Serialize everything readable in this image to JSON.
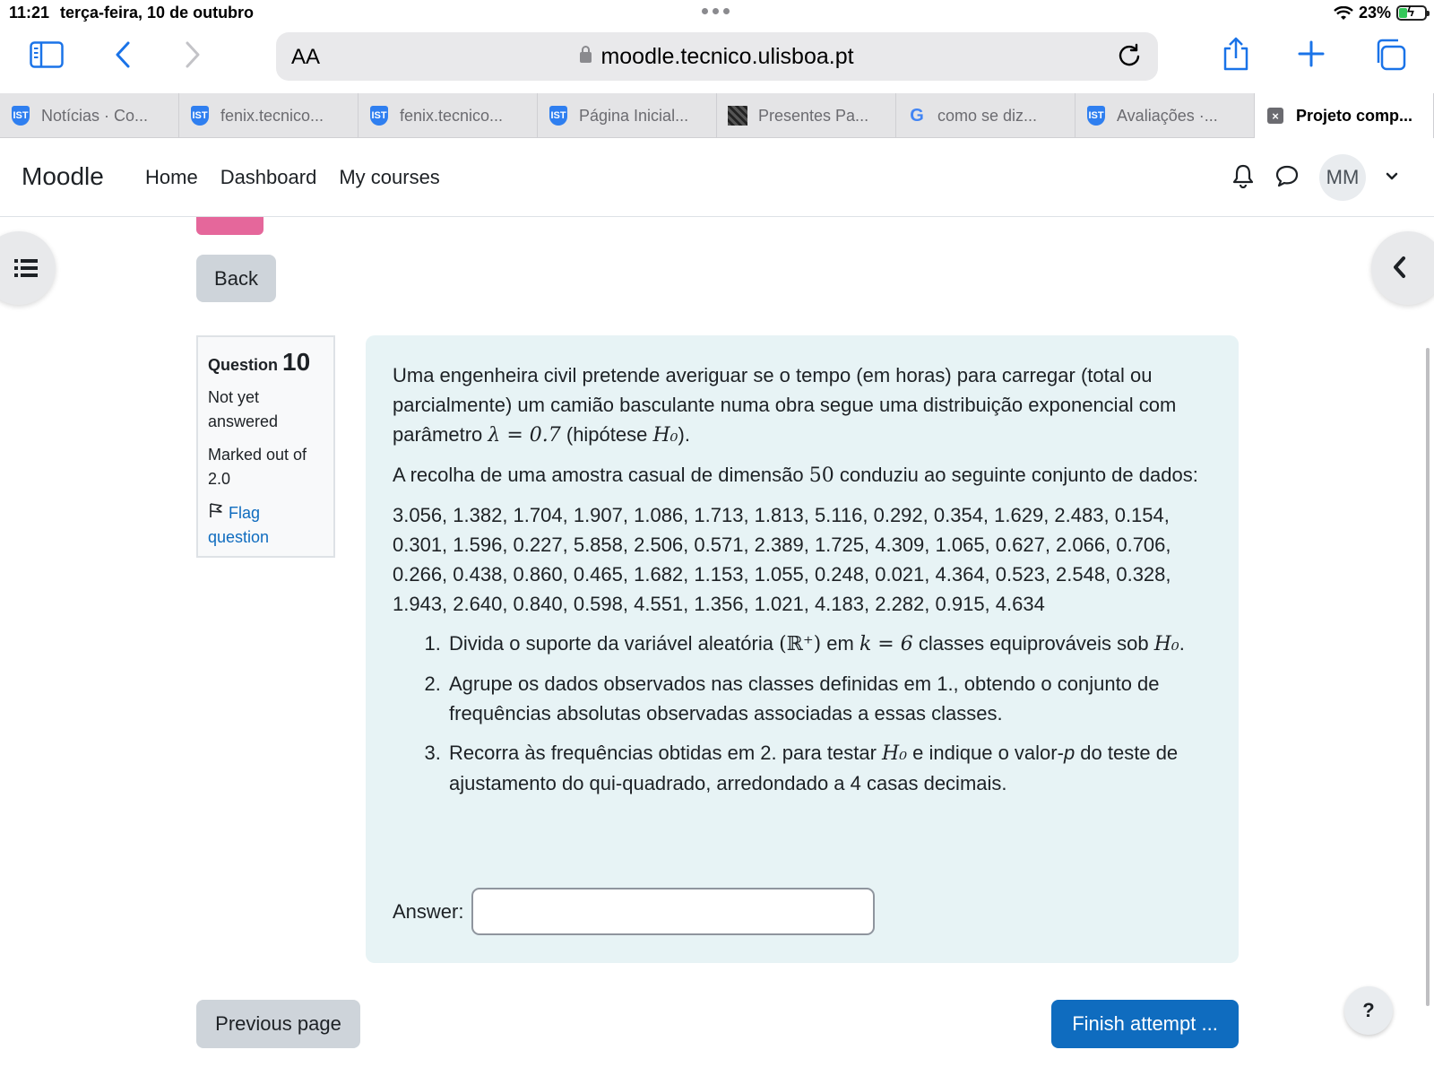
{
  "status": {
    "time": "11:21",
    "date": "terça-feira, 10 de outubro",
    "battery": "23%"
  },
  "browser": {
    "aa_label": "AA",
    "url": "moodle.tecnico.ulisboa.pt",
    "tabs": [
      {
        "label": "Notícias · Co...",
        "icon": "shield-icon"
      },
      {
        "label": "fenix.tecnico...",
        "icon": "shield-icon"
      },
      {
        "label": "fenix.tecnico...",
        "icon": "shield-icon"
      },
      {
        "label": "Página Inicial...",
        "icon": "shield-icon"
      },
      {
        "label": "Presentes Pa...",
        "icon": "pattern-icon"
      },
      {
        "label": "como se diz...",
        "icon": "google-icon"
      },
      {
        "label": "Avaliações ·...",
        "icon": "shield-icon"
      },
      {
        "label": "Projeto comp...",
        "icon": "close-icon",
        "active": true
      }
    ]
  },
  "nav": {
    "brand": "Moodle",
    "links": [
      "Home",
      "Dashboard",
      "My courses"
    ],
    "user_initials": "MM"
  },
  "back_label": "Back",
  "question_info": {
    "prefix": "Question",
    "number": "10",
    "state": "Not yet answered",
    "marks": "Marked out of 2.0",
    "flag": "Flag question"
  },
  "question": {
    "p1_a": "Uma engenheira civil pretende averiguar se o tempo (em horas) para carregar (total ou parcialmente) um camião basculante numa obra segue uma distribuição exponencial com parâmetro ",
    "p1_math": "λ = 0.7",
    "p1_b": " (hipótese ",
    "h0": "H₀",
    "p1_c": ").",
    "p2_a": "A recolha de uma amostra casual de dimensão ",
    "p2_n": "50",
    "p2_b": " conduziu ao seguinte conjunto de dados:",
    "data": "3.056, 1.382, 1.704, 1.907, 1.086, 1.713, 1.813, 5.116, 0.292, 0.354, 1.629, 2.483, 0.154, 0.301, 1.596, 0.227, 5.858, 2.506, 0.571, 2.389, 1.725, 4.309, 1.065, 0.627, 2.066, 0.706, 0.266, 0.438, 0.860, 0.465, 1.682, 1.153, 1.055, 0.248, 0.021, 4.364, 0.523, 2.548, 0.328, 1.943, 2.640, 0.840, 0.598, 4.551, 1.356, 1.021, 4.183, 2.282, 0.915, 4.634",
    "item1_a": "Divida o suporte da variável aleatória ",
    "item1_math": "(ℝ⁺)",
    "item1_b": " em ",
    "item1_k": "k = 6",
    "item1_c": " classes equiprováveis sob ",
    "item1_d": ".",
    "item2": "Agrupe os dados observados nas classes definidas em 1., obtendo o conjunto de frequências absolutas observadas associadas a essas classes.",
    "item3_a": "Recorra às frequências obtidas em 2. para testar ",
    "item3_b": " e indique o valor-",
    "item3_p": "p",
    "item3_c": " do teste de ajustamento do qui-quadrado, arredondado a 4 casas decimais.",
    "answer_label": "Answer:",
    "answer_value": ""
  },
  "footer": {
    "prev_label": "Previous page",
    "finish_label": "Finish attempt ...",
    "help": "?"
  },
  "colors": {
    "primary": "#0f6cbf",
    "question_bg": "#e7f3f5",
    "pink": "#e5679b"
  }
}
